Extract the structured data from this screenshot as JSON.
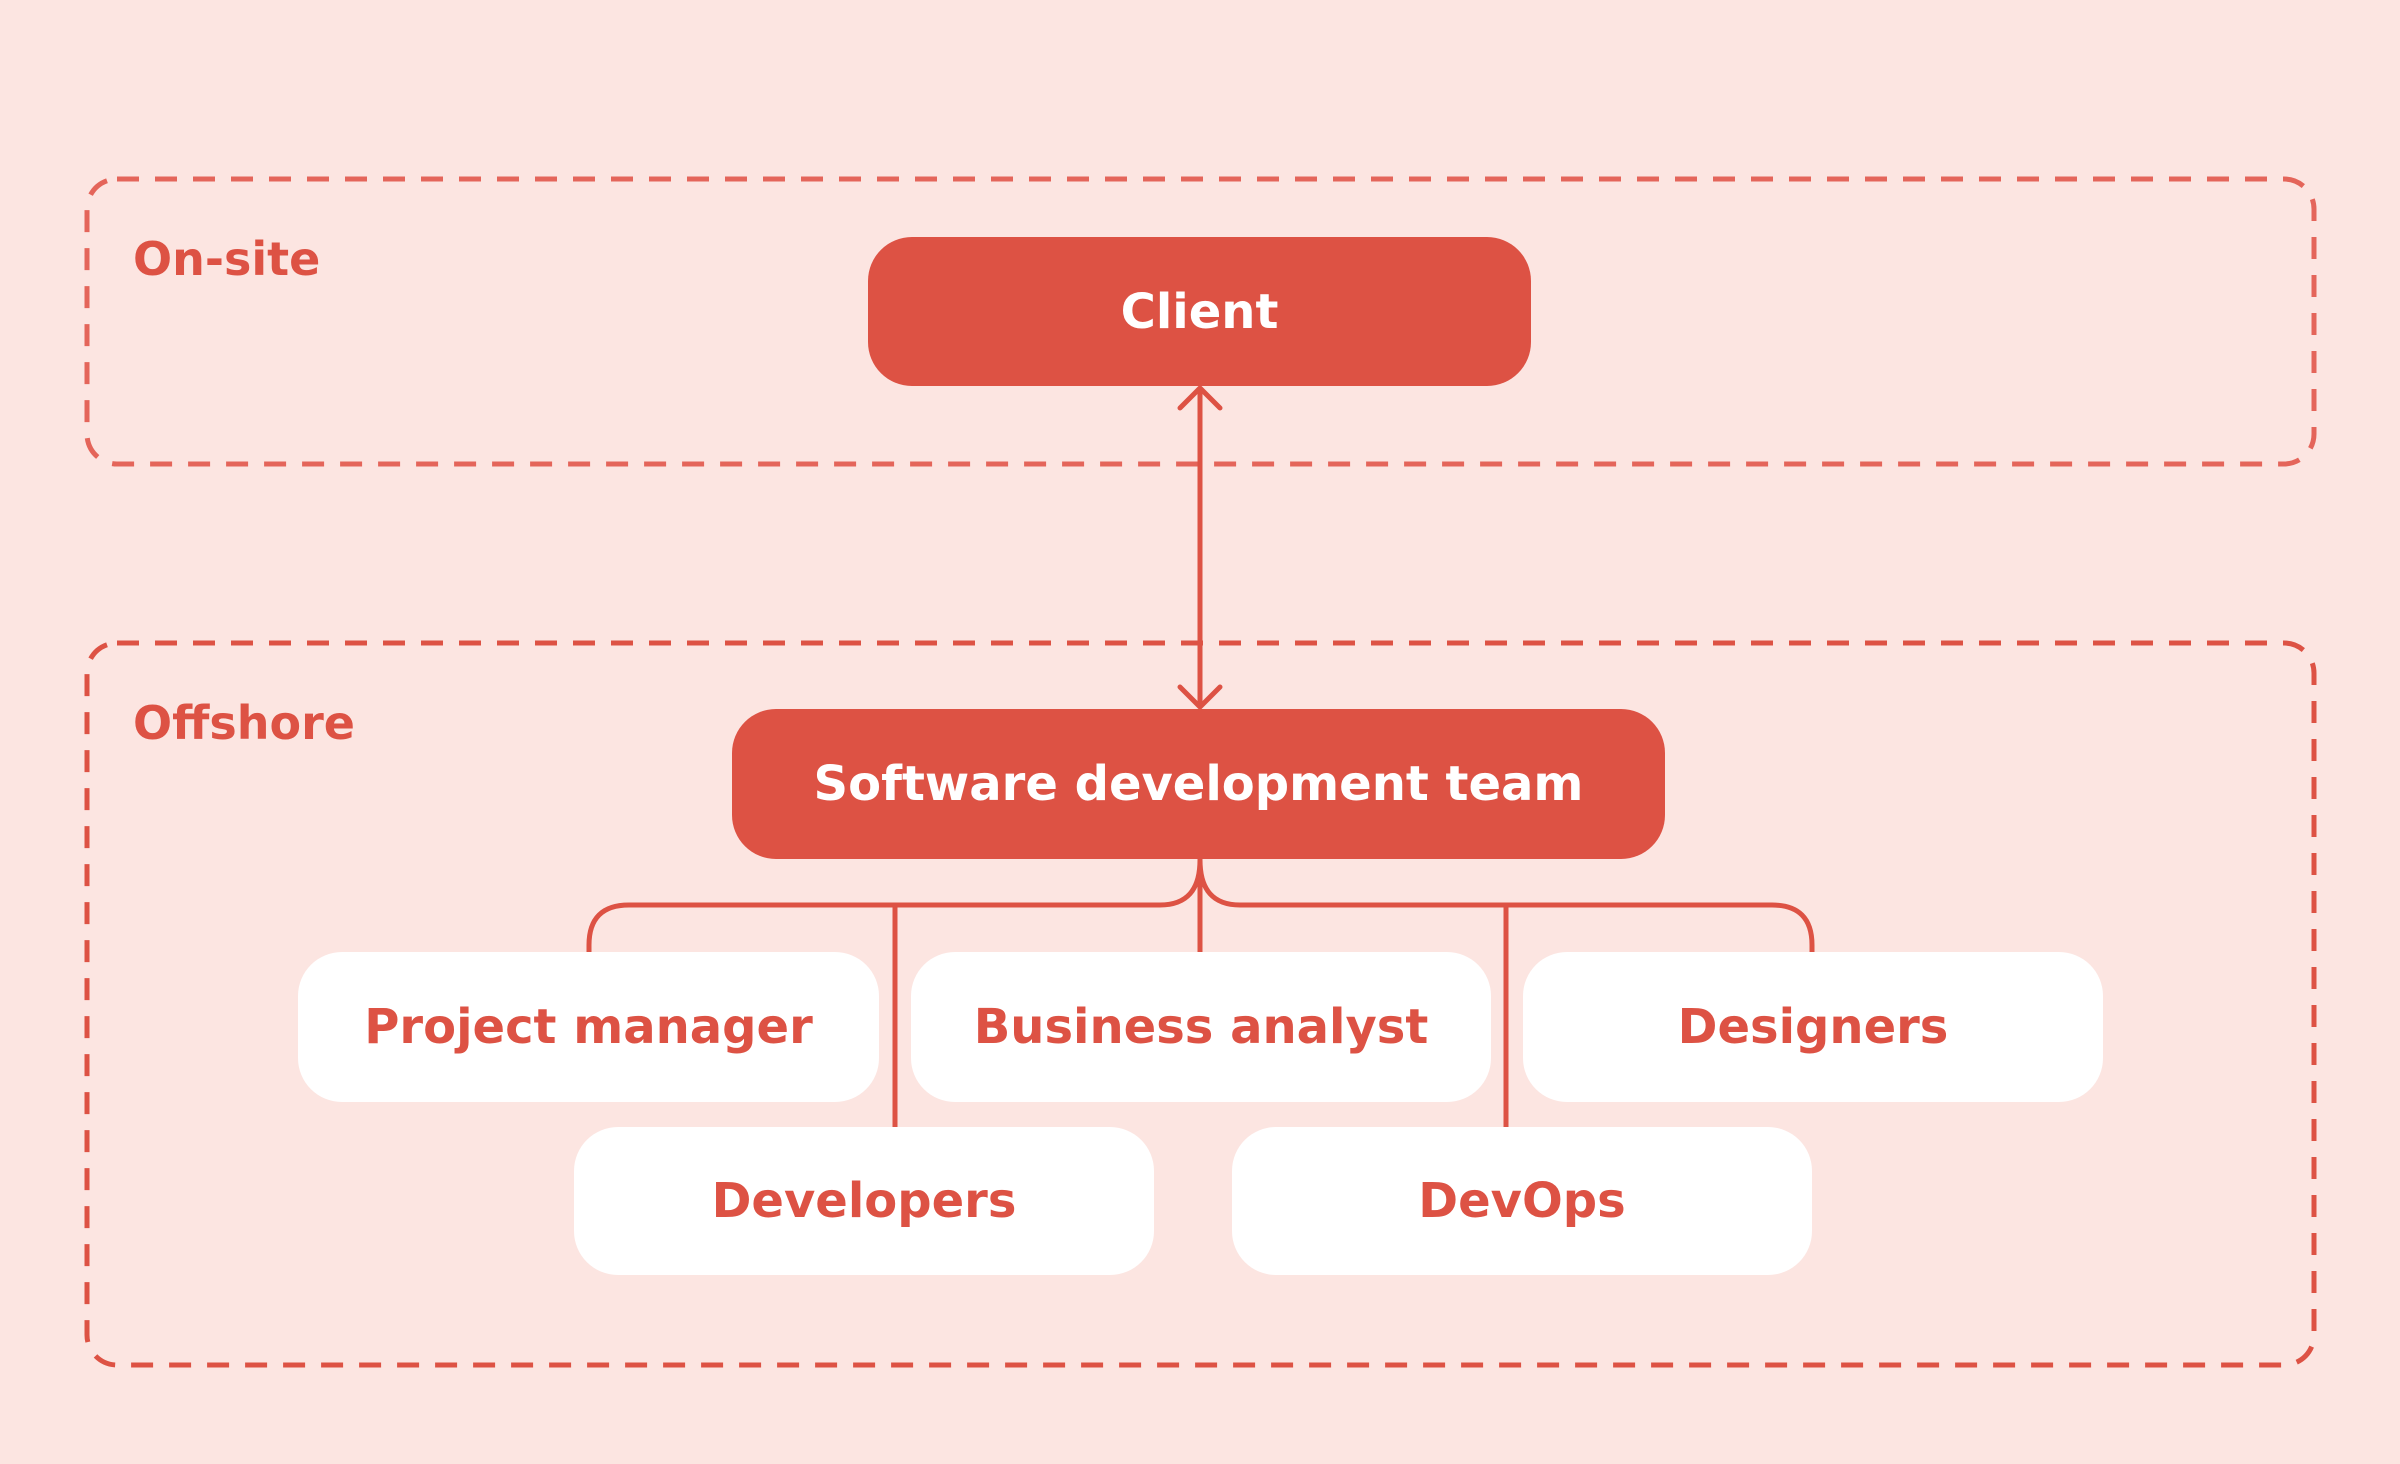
{
  "colors": {
    "background": "#fce5e1",
    "accent": "#dd5244",
    "dashed_border": "#e4655a",
    "node_secondary_bg": "#ffffff"
  },
  "zones": {
    "onsite": "On-site",
    "offshore": "Offshore"
  },
  "nodes": {
    "client": "Client",
    "team": "Software development team",
    "roles": [
      "Project manager",
      "Business analyst",
      "Designers",
      "Developers",
      "DevOps"
    ]
  },
  "edges": [
    {
      "from": "client",
      "to": "team",
      "type": "bidirectional-arrow"
    },
    {
      "from": "team",
      "to": "Project manager"
    },
    {
      "from": "team",
      "to": "Business analyst"
    },
    {
      "from": "team",
      "to": "Designers"
    },
    {
      "from": "team",
      "to": "Developers"
    },
    {
      "from": "team",
      "to": "DevOps"
    }
  ]
}
